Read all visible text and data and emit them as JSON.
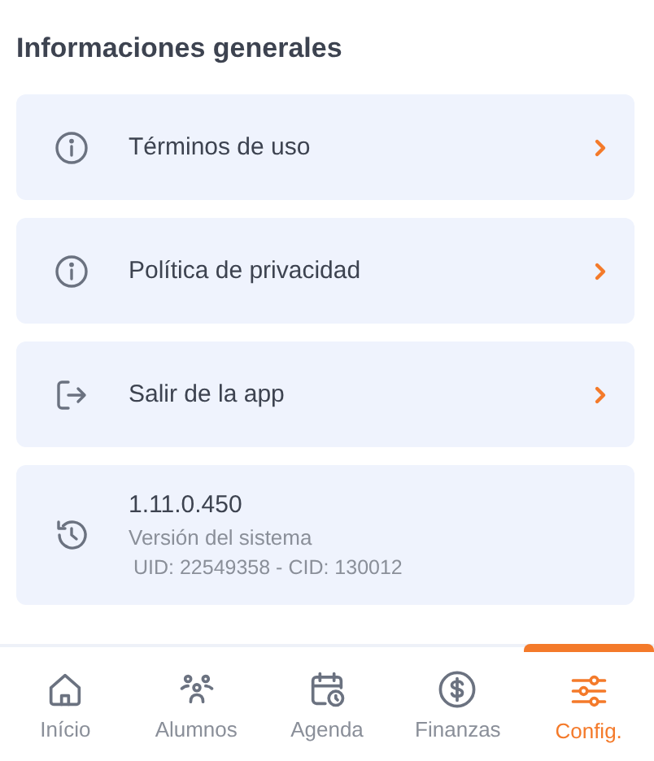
{
  "section": {
    "title": "Informaciones generales"
  },
  "items": [
    {
      "label": "Términos de uso"
    },
    {
      "label": "Política de privacidad"
    },
    {
      "label": "Salir de la app"
    }
  ],
  "version": {
    "number": "1.11.0.450",
    "caption": "Versión del sistema",
    "ids": "UID: 22549358 - CID: 130012"
  },
  "nav": [
    {
      "label": "Início",
      "selected": false
    },
    {
      "label": "Alumnos",
      "selected": false
    },
    {
      "label": "Agenda",
      "selected": false
    },
    {
      "label": "Finanzas",
      "selected": false
    },
    {
      "label": "Config.",
      "selected": true
    }
  ]
}
